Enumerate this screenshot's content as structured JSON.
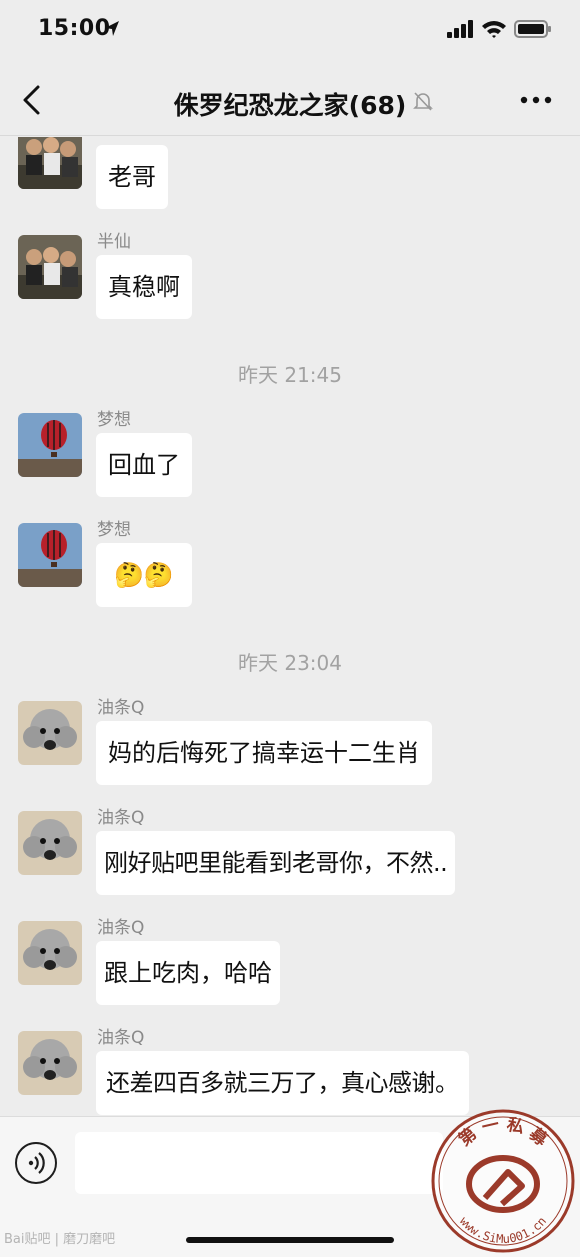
{
  "status_bar": {
    "time": "15:00"
  },
  "nav": {
    "title": "侏罗纪恐龙之家(68)"
  },
  "messages": [
    {
      "sender": "半仙",
      "text": "老哥"
    },
    {
      "sender": "半仙",
      "text": "真稳啊"
    },
    {
      "sender": "梦想",
      "text": "回血了"
    },
    {
      "sender": "梦想",
      "text": "🤔🤔"
    },
    {
      "sender": "油条Q",
      "text": "妈的后悔死了搞幸运十二生肖"
    },
    {
      "sender": "油条Q",
      "text": "刚好贴吧里能看到老哥你，不然.."
    },
    {
      "sender": "油条Q",
      "text": "跟上吃肉，哈哈"
    },
    {
      "sender": "油条Q",
      "text": "还差四百多就三万了，真心感谢。"
    }
  ],
  "time_separators": [
    "昨天 21:45",
    "昨天 23:04"
  ],
  "watermarks": {
    "left": "Bai贴吧 | 磨刀磨吧",
    "stamp_top": "第 一 私 募",
    "stamp_url": "www.SiMu001.cn"
  }
}
